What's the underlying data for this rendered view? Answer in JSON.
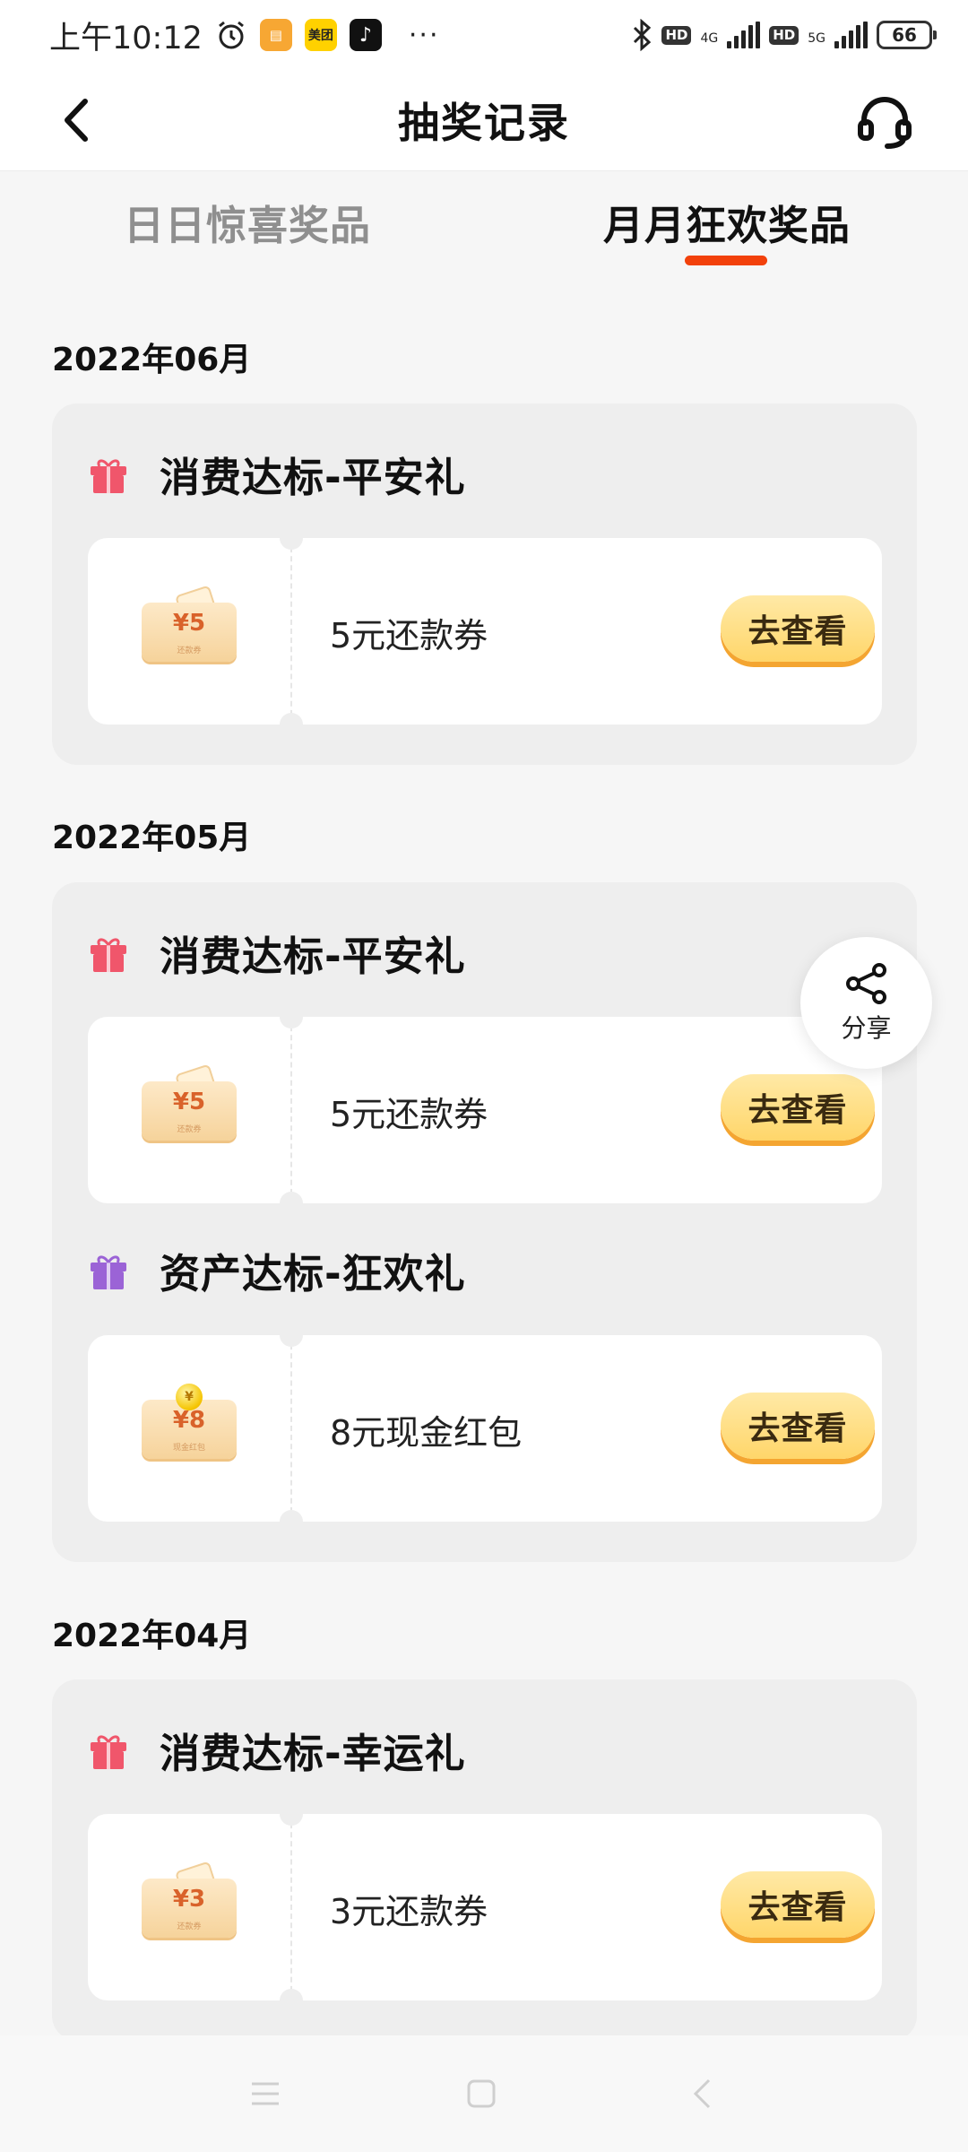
{
  "status_bar": {
    "time": "上午10:12",
    "app_meituan": "美团",
    "more": "···",
    "hd": "HD",
    "net1": "4G",
    "net2": "5G",
    "battery": "66"
  },
  "header": {
    "title": "抽奖记录"
  },
  "tabs": {
    "daily": "日日惊喜奖品",
    "monthly": "月月狂欢奖品",
    "active": "monthly"
  },
  "sections": [
    {
      "month": "2022年06月",
      "groups": [
        {
          "title": "消费达标-平安礼",
          "icon_color": "#f0566b",
          "prizes": [
            {
              "coupon_amount": "¥5",
              "coupon_sub": "还款券",
              "name": "5元还款券",
              "button": "去查看"
            }
          ]
        }
      ]
    },
    {
      "month": "2022年05月",
      "groups": [
        {
          "title": "消费达标-平安礼",
          "icon_color": "#f0566b",
          "prizes": [
            {
              "coupon_amount": "¥5",
              "coupon_sub": "还款券",
              "name": "5元还款券",
              "button": "去查看"
            }
          ]
        },
        {
          "title": "资产达标-狂欢礼",
          "icon_color": "#9b63d6",
          "prizes": [
            {
              "coupon_amount": "¥8",
              "coupon_sub": "现金红包",
              "name": "8元现金红包",
              "button": "去查看"
            }
          ]
        }
      ]
    },
    {
      "month": "2022年04月",
      "groups": [
        {
          "title": "消费达标-幸运礼",
          "icon_color": "#f0566b",
          "prizes": [
            {
              "coupon_amount": "¥3",
              "coupon_sub": "还款券",
              "name": "3元还款券",
              "button": "去查看"
            }
          ]
        }
      ]
    }
  ],
  "share": {
    "label": "分享"
  },
  "colors": {
    "accent": "#f2410b",
    "button_fill": "#ffd66a",
    "card_bg": "#eeeeee"
  }
}
